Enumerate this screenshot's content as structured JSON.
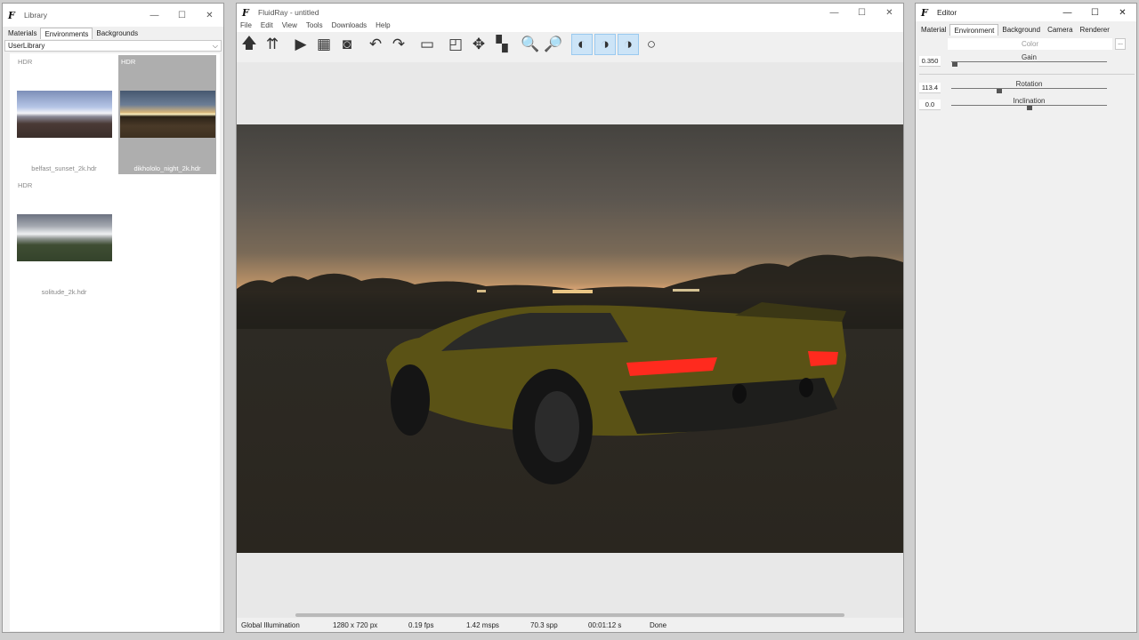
{
  "library": {
    "title": "Library",
    "tabs": [
      "Materials",
      "Environments",
      "Backgrounds"
    ],
    "active_tab": "Environments",
    "dropdown_value": "UserLibrary",
    "items": [
      {
        "badge": "HDR",
        "name": "belfast_sunset_2k.hdr",
        "selected": false
      },
      {
        "badge": "HDR",
        "name": "dikhololo_night_2k.hdr",
        "selected": true
      },
      {
        "badge": "HDR",
        "name": "solitude_2k.hdr",
        "selected": false
      }
    ]
  },
  "main": {
    "title": "FluidRay - untitled",
    "menu": [
      "File",
      "Edit",
      "View",
      "Tools",
      "Downloads",
      "Help"
    ],
    "toolbar_icons": [
      "upload-icon",
      "upload-multi-icon",
      "play-icon",
      "film-icon",
      "save-icon",
      "undo-icon",
      "redo-icon",
      "window-icon",
      "region-icon",
      "move-icon",
      "pixel-icon",
      "zoom-out-icon",
      "zoom-in-icon",
      "shade-left-icon",
      "shade-both-icon",
      "shade-right-icon",
      "circle-icon"
    ],
    "status": {
      "mode": "Global Illumination",
      "resolution": "1280 x 720 px",
      "fps": "0.19 fps",
      "msps": "1.42 msps",
      "spp": "70.3 spp",
      "time": "00:01:12 s",
      "state": "Done"
    }
  },
  "editor": {
    "title": "Editor",
    "tabs": [
      "Material",
      "Environment",
      "Background",
      "Camera",
      "Renderer"
    ],
    "active_tab": "Environment",
    "color_label": "Color",
    "more_label": "...",
    "gain": {
      "label": "Gain",
      "value": "0.350",
      "fraction": 0.02
    },
    "rotation": {
      "label": "Rotation",
      "value": "113.4",
      "fraction": 0.31
    },
    "inclination": {
      "label": "Inclination",
      "value": "0.0",
      "fraction": 0.5
    }
  },
  "window_buttons": {
    "minimize": "—",
    "maximize": "☐",
    "close": "✕"
  }
}
